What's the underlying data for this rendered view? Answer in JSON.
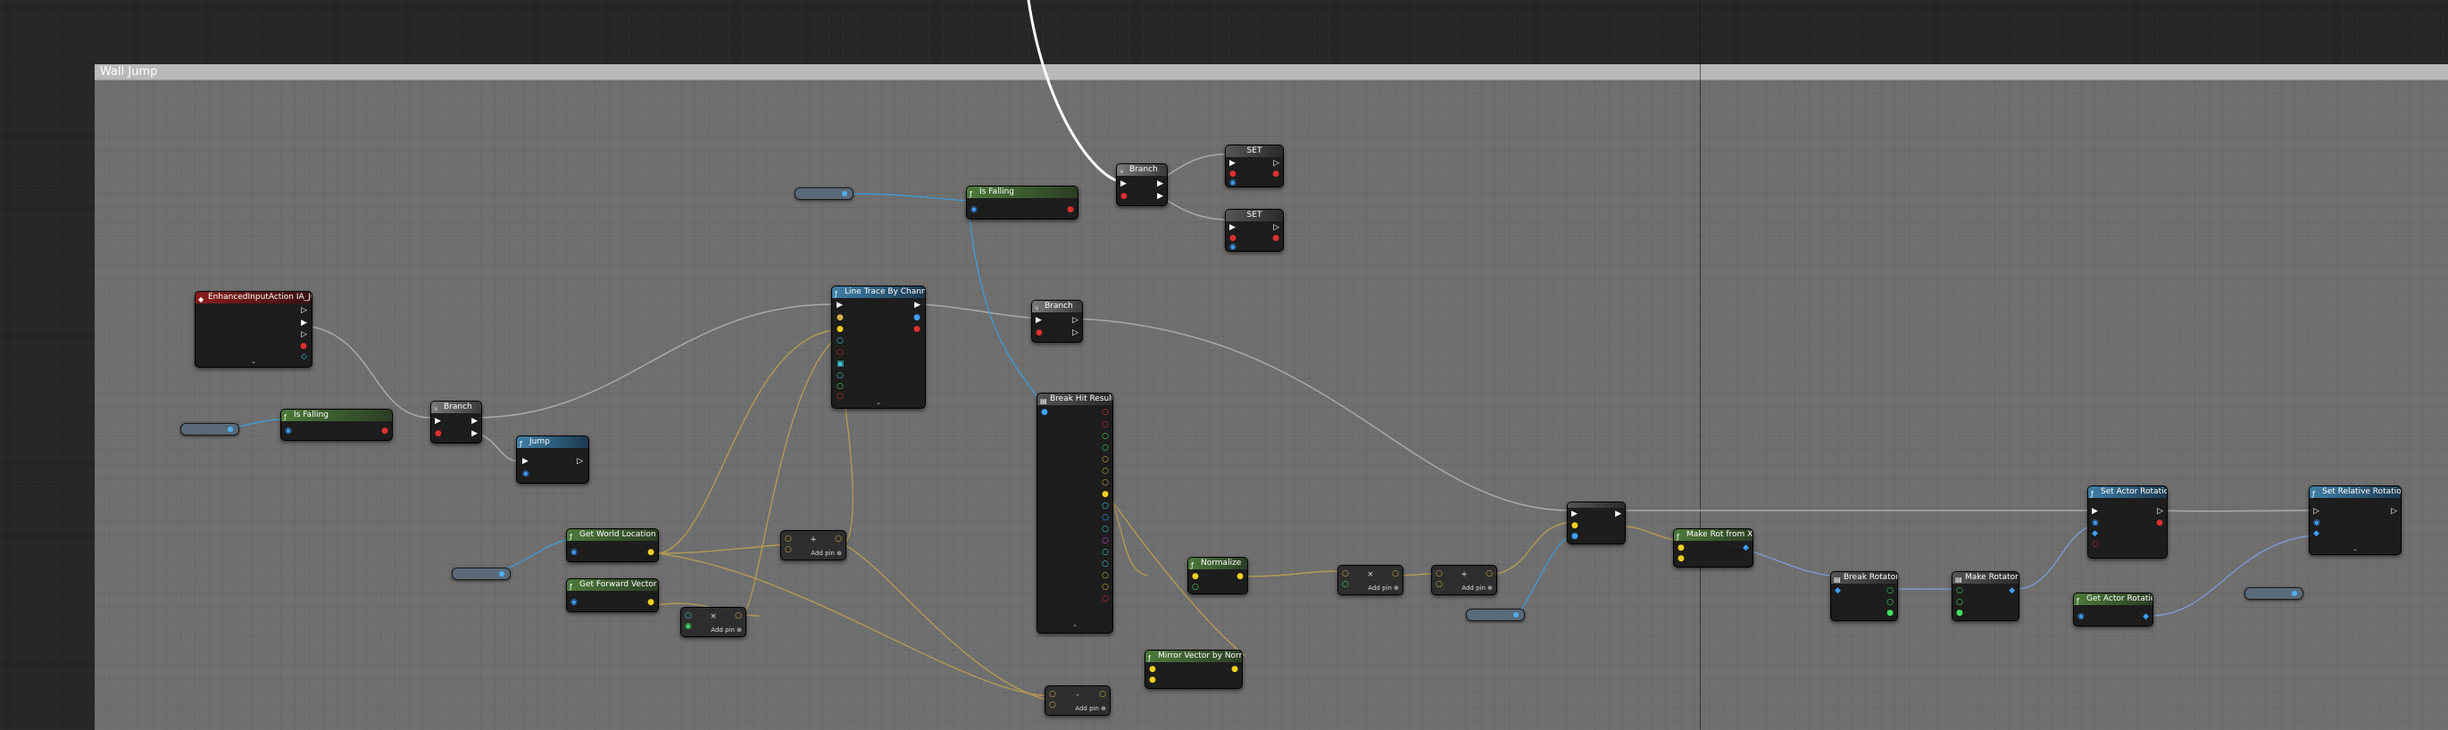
{
  "comment": {
    "title": "Wall Jump"
  },
  "colors": {
    "exec_wire": "#ffffff",
    "vector_wire": "#b59a55",
    "object_wire": "#3aa0e0",
    "comment_bg": "#8c8c8c"
  },
  "nodes": {
    "event": {
      "title": "EnhancedInputAction IA_Jump"
    },
    "is_falling_1": {
      "title": "Is Falling"
    },
    "is_falling_2": {
      "title": "Is Falling"
    },
    "branch_1": {
      "title": "Branch"
    },
    "branch_2": {
      "title": "Branch"
    },
    "branch_3": {
      "title": "Branch"
    },
    "jump": {
      "title": "Jump"
    },
    "set_1": {
      "title": "SET"
    },
    "set_2": {
      "title": "SET"
    },
    "line_trace": {
      "title": "Line Trace By Channel"
    },
    "break_hit": {
      "title": "Break Hit Result"
    },
    "get_world_location": {
      "title": "Get World Location"
    },
    "get_forward_vector": {
      "title": "Get Forward Vector"
    },
    "normalize": {
      "title": "Normalize"
    },
    "mirror_vector": {
      "title": "Mirror Vector by Normal"
    },
    "make_rot": {
      "title": "Make Rot from X"
    },
    "break_rotator": {
      "title": "Break Rotator"
    },
    "make_rotator": {
      "title": "Make Rotator"
    },
    "set_actor_rotation": {
      "title": "Set Actor Rotation"
    },
    "get_actor_rotation": {
      "title": "Get Actor Rotation"
    },
    "set_relative_rotation": {
      "title": "Set Relative Rotation"
    }
  },
  "math_nodes": {
    "add_1": {
      "op": "+",
      "add_pin": "Add pin"
    },
    "mul_1": {
      "op": "×",
      "add_pin": "Add pin"
    },
    "sub_1": {
      "op": "-",
      "add_pin": "Add pin"
    },
    "mul_2": {
      "op": "×",
      "add_pin": "Add pin"
    },
    "add_2": {
      "op": "+",
      "add_pin": "Add pin"
    }
  },
  "icons": {
    "function": "f-icon",
    "event": "event-icon",
    "expand": "chevron-down-icon"
  }
}
